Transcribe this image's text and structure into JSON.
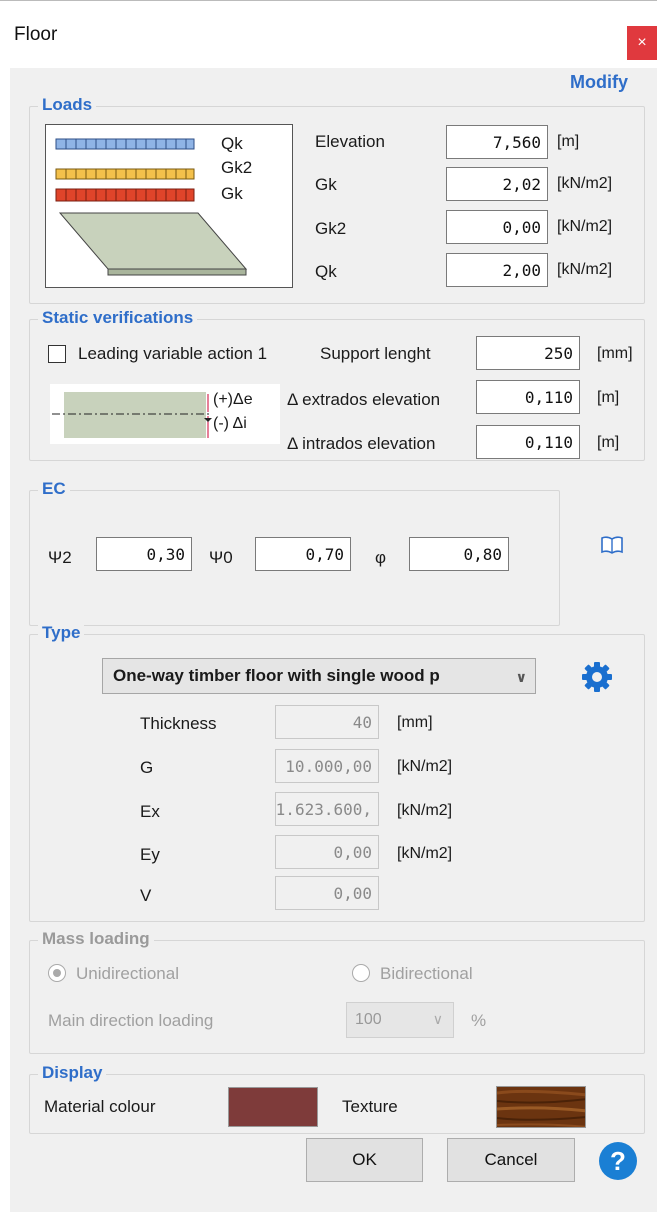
{
  "window": {
    "title": "Floor",
    "close": "×"
  },
  "modify_label": "Modify",
  "loads": {
    "group_label": "Loads",
    "legend": [
      "Qk",
      "Gk2",
      "Gk"
    ],
    "fields": [
      {
        "label": "Elevation",
        "value": "7,560",
        "unit": "[m]"
      },
      {
        "label": "Gk",
        "value": "2,02",
        "unit": "[kN/m2]"
      },
      {
        "label": "Gk2",
        "value": "0,00",
        "unit": "[kN/m2]"
      },
      {
        "label": "Qk",
        "value": "2,00",
        "unit": "[kN/m2]"
      }
    ]
  },
  "static": {
    "group_label": "Static verifications",
    "checkbox_label": "Leading variable action 1",
    "checked": false,
    "diagram_top": "(+)Δe",
    "diagram_bottom": "(-) Δi",
    "fields": [
      {
        "label": "Support lenght",
        "value": "250",
        "unit": "[mm]"
      },
      {
        "label": "Δ extrados elevation",
        "value": "0,110",
        "unit": "[m]"
      },
      {
        "label": "Δ intrados elevation",
        "value": "0,110",
        "unit": "[m]"
      }
    ]
  },
  "ec": {
    "group_label": "EC",
    "psi2_label": "Ψ2",
    "psi2_value": "0,30",
    "psi0_label": "Ψ0",
    "psi0_value": "0,70",
    "phi_label": "φ",
    "phi_value": "0,80",
    "book_icon": "book-icon"
  },
  "type": {
    "group_label": "Type",
    "selected": "One-way timber floor with single wood p",
    "settings_icon": "gear-icon",
    "fields": [
      {
        "label": "Thickness",
        "value": "40",
        "unit": "[mm]"
      },
      {
        "label": "G",
        "value": "10.000,00",
        "unit": "[kN/m2]"
      },
      {
        "label": "Ex",
        "value": "1.623.600,",
        "unit": "[kN/m2]"
      },
      {
        "label": "Ey",
        "value": "0,00",
        "unit": "[kN/m2]"
      },
      {
        "label": "V",
        "value": "0,00",
        "unit": ""
      }
    ]
  },
  "mass": {
    "group_label": "Mass loading",
    "unidirectional": "Unidirectional",
    "bidirectional": "Bidirectional",
    "selected": "Unidirectional",
    "main_direction_label": "Main direction loading",
    "main_direction_value": "100",
    "main_direction_unit": "%"
  },
  "display": {
    "group_label": "Display",
    "material_colour_label": "Material colour",
    "material_colour": "#7e3b3a",
    "texture_label": "Texture"
  },
  "buttons": {
    "ok": "OK",
    "cancel": "Cancel",
    "help": "?"
  },
  "colors": {
    "accent": "#2f6ec9",
    "close": "#e0393e",
    "help": "#1a7fd4"
  }
}
